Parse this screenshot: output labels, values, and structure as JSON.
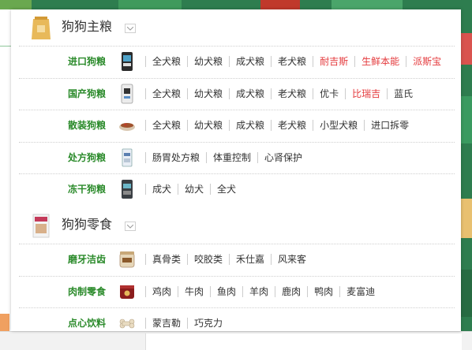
{
  "categories": [
    {
      "title": "狗狗主粮",
      "icon": "dog-food-bag-icon",
      "rows": [
        {
          "label": "进口狗粮",
          "icon": "imported-food-bag-icon",
          "links": [
            {
              "text": "全犬粮",
              "hot": false
            },
            {
              "text": "幼犬粮",
              "hot": false
            },
            {
              "text": "成犬粮",
              "hot": false
            },
            {
              "text": "老犬粮",
              "hot": false
            },
            {
              "text": "耐吉斯",
              "hot": true
            },
            {
              "text": "生鲜本能",
              "hot": true
            },
            {
              "text": "派斯宝",
              "hot": true
            }
          ]
        },
        {
          "label": "国产狗粮",
          "icon": "domestic-food-bag-icon",
          "links": [
            {
              "text": "全犬粮",
              "hot": false
            },
            {
              "text": "幼犬粮",
              "hot": false
            },
            {
              "text": "成犬粮",
              "hot": false
            },
            {
              "text": "老犬粮",
              "hot": false
            },
            {
              "text": "优卡",
              "hot": false
            },
            {
              "text": "比瑞吉",
              "hot": true
            },
            {
              "text": "蓝氏",
              "hot": false
            }
          ]
        },
        {
          "label": "散装狗粮",
          "icon": "bulk-food-bowl-icon",
          "links": [
            {
              "text": "全犬粮",
              "hot": false
            },
            {
              "text": "幼犬粮",
              "hot": false
            },
            {
              "text": "成犬粮",
              "hot": false
            },
            {
              "text": "老犬粮",
              "hot": false
            },
            {
              "text": "小型犬粮",
              "hot": false
            },
            {
              "text": "进口拆零",
              "hot": false
            }
          ]
        },
        {
          "label": "处方狗粮",
          "icon": "prescription-food-bag-icon",
          "links": [
            {
              "text": "肠胃处方粮",
              "hot": false
            },
            {
              "text": "体重控制",
              "hot": false
            },
            {
              "text": "心肾保护",
              "hot": false
            }
          ]
        },
        {
          "label": "冻干狗粮",
          "icon": "freeze-dried-bag-icon",
          "links": [
            {
              "text": "成犬",
              "hot": false
            },
            {
              "text": "幼犬",
              "hot": false
            },
            {
              "text": "全犬",
              "hot": false
            }
          ]
        }
      ]
    },
    {
      "title": "狗狗零食",
      "icon": "dog-snack-bag-icon",
      "rows": [
        {
          "label": "磨牙洁齿",
          "icon": "dental-chew-jar-icon",
          "links": [
            {
              "text": "真骨类",
              "hot": false
            },
            {
              "text": "咬胶类",
              "hot": false
            },
            {
              "text": "禾仕嘉",
              "hot": false
            },
            {
              "text": "风来客",
              "hot": false
            }
          ]
        },
        {
          "label": "肉制零食",
          "icon": "meat-snack-can-icon",
          "links": [
            {
              "text": "鸡肉",
              "hot": false
            },
            {
              "text": "牛肉",
              "hot": false
            },
            {
              "text": "鱼肉",
              "hot": false
            },
            {
              "text": "羊肉",
              "hot": false
            },
            {
              "text": "鹿肉",
              "hot": false
            },
            {
              "text": "鸭肉",
              "hot": false
            },
            {
              "text": "麦富迪",
              "hot": false
            }
          ]
        },
        {
          "label": "点心饮料",
          "icon": "bone-biscuit-icon",
          "links": [
            {
              "text": "蒙吉勒",
              "hot": false
            },
            {
              "text": "巧克力",
              "hot": false
            }
          ]
        }
      ]
    }
  ],
  "colors": {
    "row_label": "#2a8a2a",
    "hot_link": "#e4393c",
    "link": "#333333",
    "background_green": "#2e7d4f"
  }
}
